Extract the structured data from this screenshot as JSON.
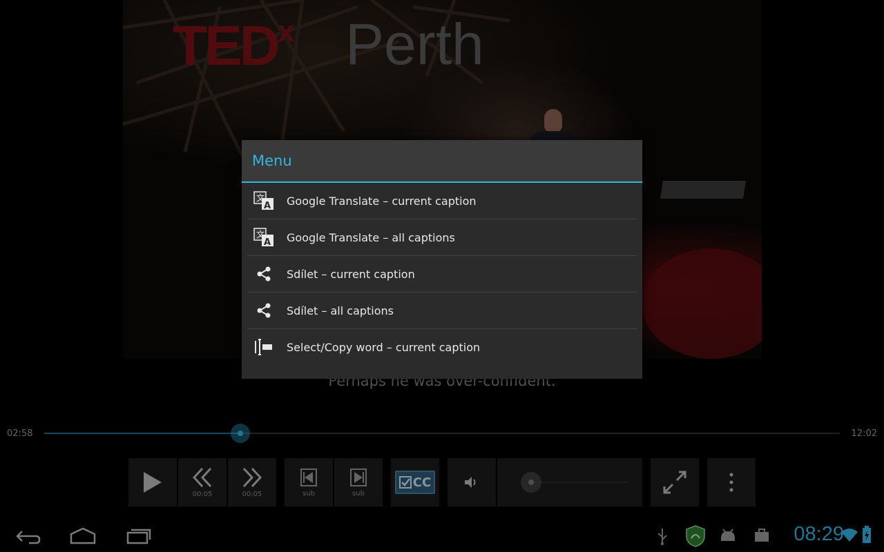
{
  "video": {
    "logo_brand": "TED",
    "logo_x": "x",
    "logo_city": "Perth",
    "caption": "Perhaps he was over-confident."
  },
  "seek": {
    "current_time": "02:58",
    "total_time": "12:02",
    "progress": 0.2465
  },
  "controls": {
    "rewind_label": "00:05",
    "forward_label": "00:05",
    "prev_sub_label": "sub",
    "next_sub_label": "sub",
    "cc_label": "CC",
    "volume_level": 0.1
  },
  "dialog": {
    "title": "Menu",
    "items": [
      {
        "label": "Google Translate – current caption",
        "icon": "translate-icon"
      },
      {
        "label": "Google Translate – all captions",
        "icon": "translate-icon"
      },
      {
        "label": "Sdílet – current caption",
        "icon": "share-icon"
      },
      {
        "label": "Sdílet – all captions",
        "icon": "share-icon"
      },
      {
        "label": "Select/Copy word – current caption",
        "icon": "text-select-icon"
      }
    ]
  },
  "status": {
    "clock": "08:29"
  },
  "colors": {
    "accent": "#33b5e5",
    "dialog_bg": "#2b2b2b",
    "header_bg": "#3a3a3a"
  }
}
